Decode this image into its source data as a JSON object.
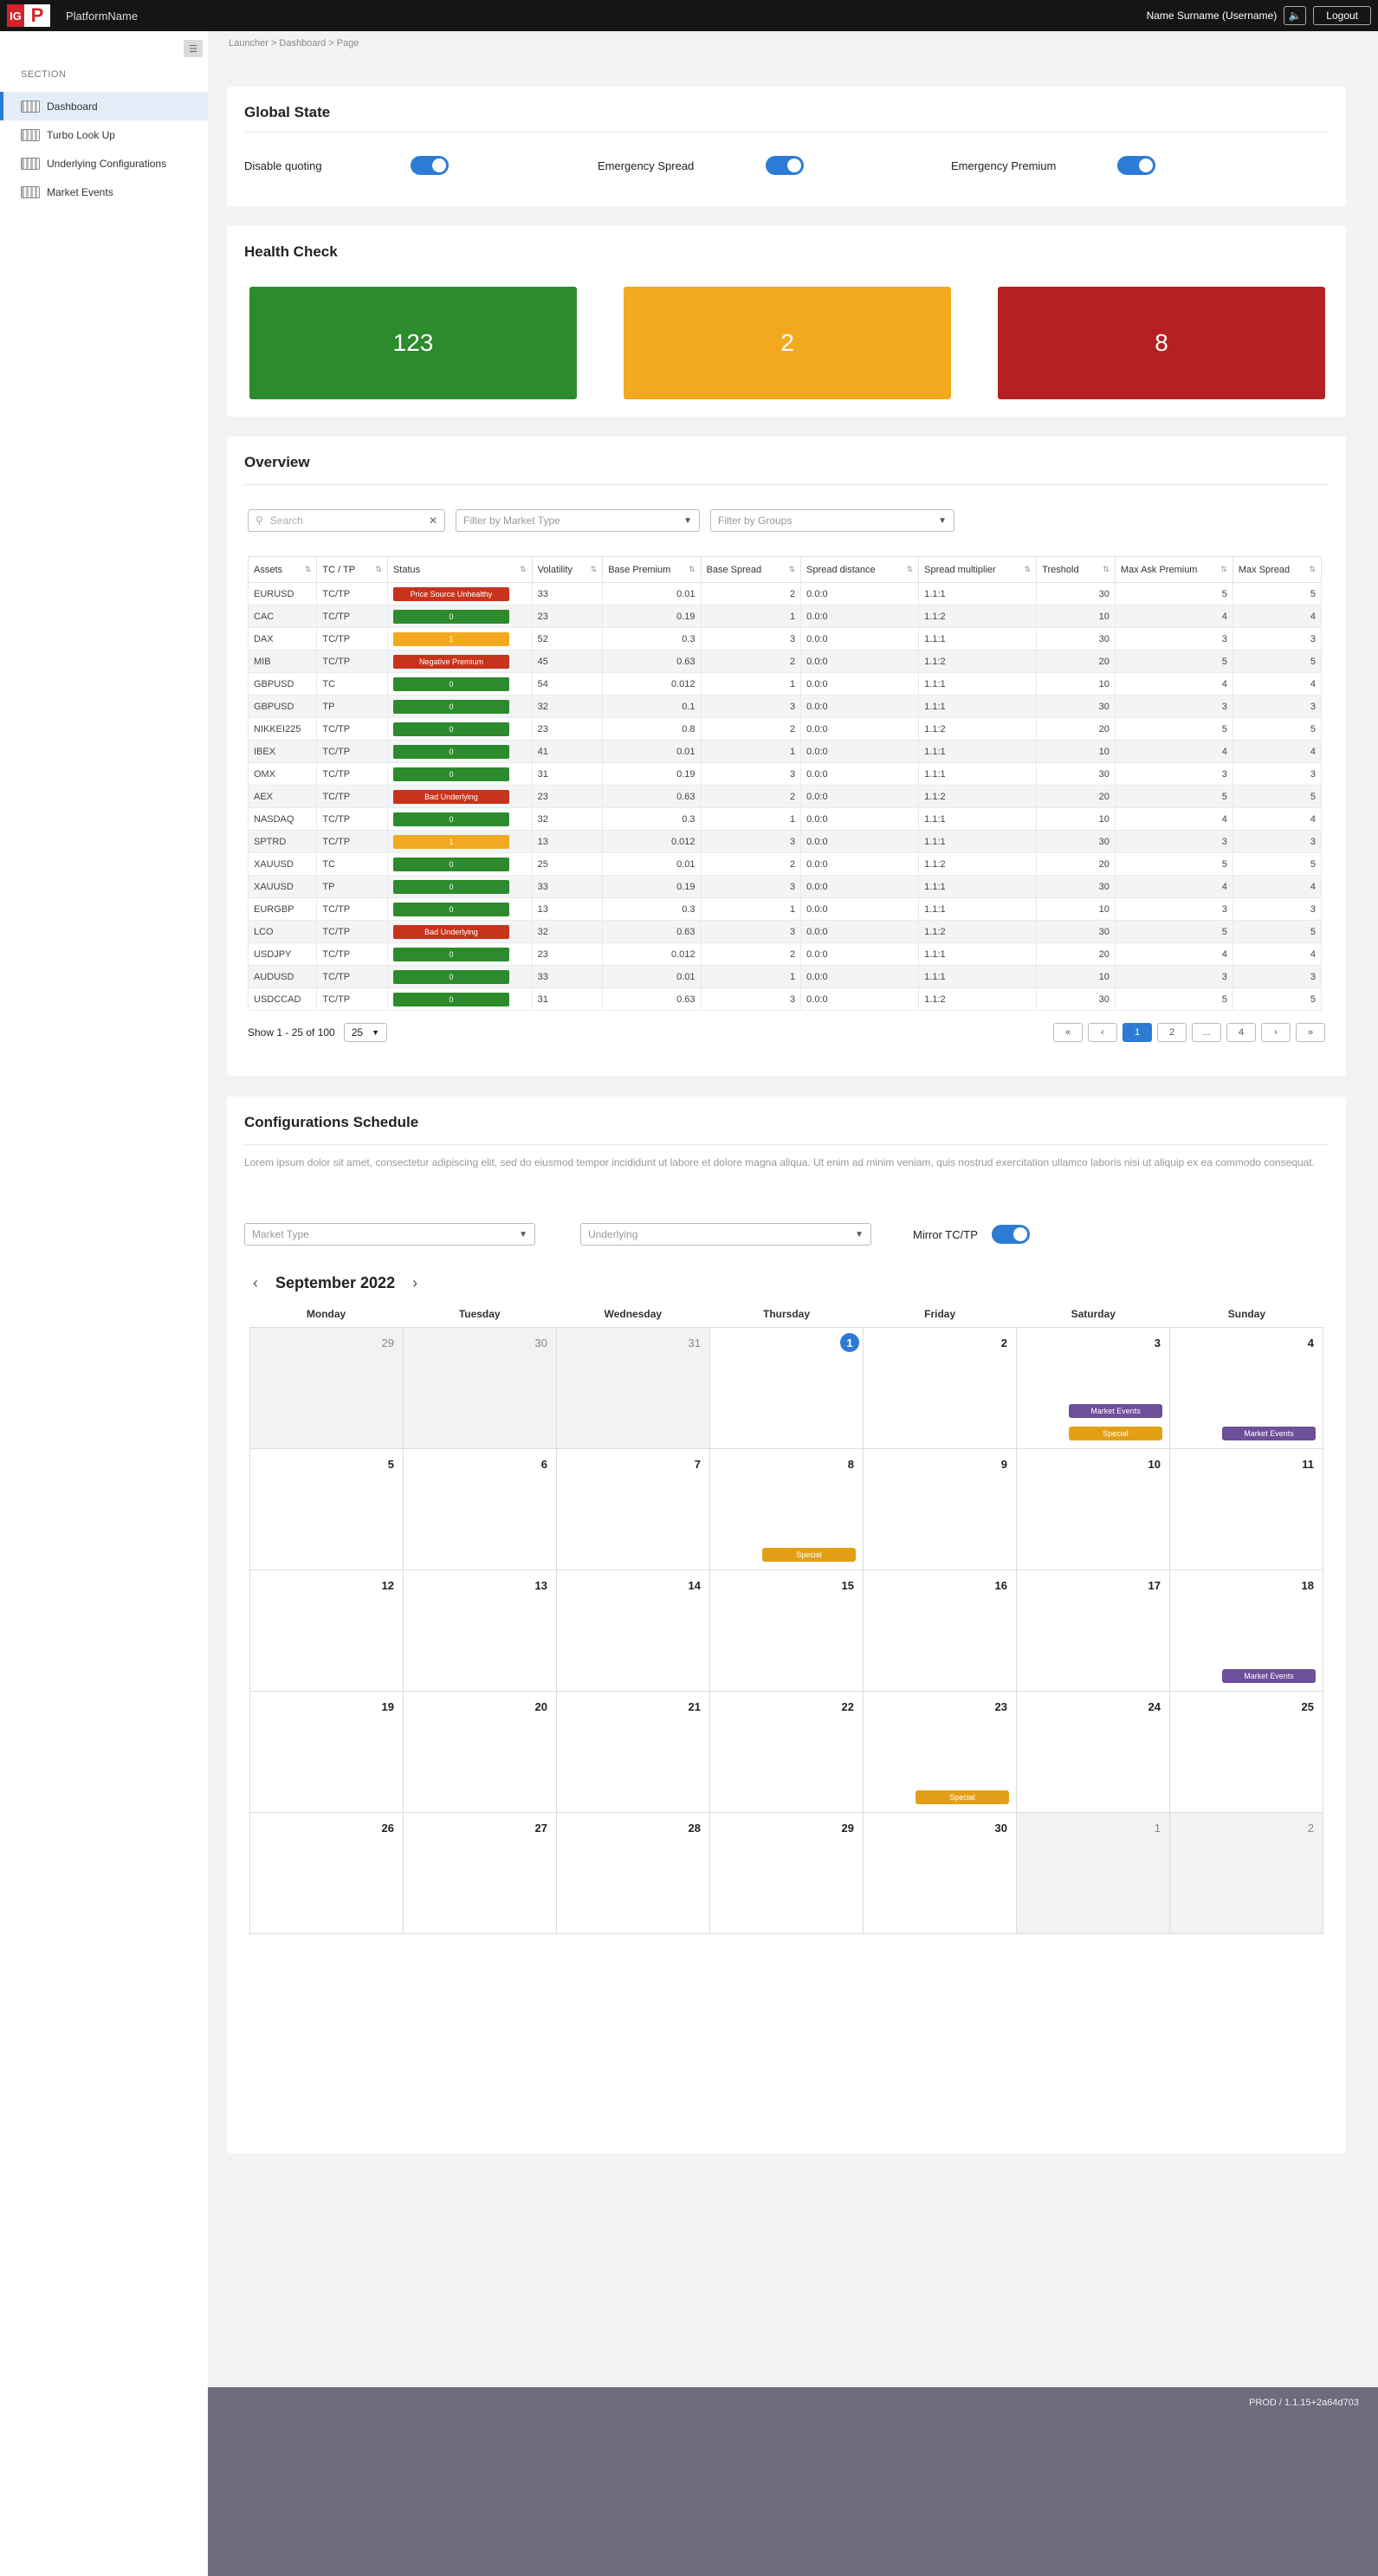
{
  "header": {
    "logo_ig": "IG",
    "logo_p": "P",
    "platform": "PlatformName",
    "username": "Name Surname (Username)",
    "logout": "Logout",
    "sound_icon": "speaker-icon"
  },
  "sidebar": {
    "section": "SECTION",
    "items": [
      {
        "label": "Dashboard",
        "active": true
      },
      {
        "label": "Turbo Look Up"
      },
      {
        "label": "Underlying Configurations"
      },
      {
        "label": "Market Events"
      }
    ]
  },
  "breadcrumb": "Launcher > Dashboard > Page",
  "global_state": {
    "title": "Global State",
    "items": [
      {
        "label": "Disable quoting",
        "on": true
      },
      {
        "label": "Emergency Spread",
        "on": true
      },
      {
        "label": "Emergency Premium",
        "on": true
      }
    ]
  },
  "health_check": {
    "title": "Health Check",
    "tiles": [
      {
        "value": "123",
        "color": "#2c8b2c"
      },
      {
        "value": "2",
        "color": "#f2a91e"
      },
      {
        "value": "8",
        "color": "#b52122"
      }
    ]
  },
  "overview": {
    "title": "Overview",
    "search_placeholder": "Search",
    "filter_market": "Filter by Market Type",
    "filter_groups": "Filter by Groups",
    "columns": [
      "Assets",
      "TC / TP",
      "Status",
      "Volatility",
      "Base Premium",
      "Base Spread",
      "Spread distance",
      "Spread multiplier",
      "Treshold",
      "Max Ask Premium",
      "Max Spread"
    ],
    "rows": [
      [
        "EURUSD",
        "TC/TP",
        "Price Source Unhealthy",
        "33",
        "0.01",
        "2",
        "0.0:0",
        "1.1:1",
        "30",
        "5",
        "5"
      ],
      [
        "CAC",
        "TC/TP",
        "0",
        "23",
        "0.19",
        "1",
        "0.0:0",
        "1.1:2",
        "10",
        "4",
        "4"
      ],
      [
        "DAX",
        "TC/TP",
        "1",
        "52",
        "0.3",
        "3",
        "0.0:0",
        "1.1:1",
        "30",
        "3",
        "3"
      ],
      [
        "MIB",
        "TC/TP",
        "Negative Premium",
        "45",
        "0.63",
        "2",
        "0.0:0",
        "1.1:2",
        "20",
        "5",
        "5"
      ],
      [
        "GBPUSD",
        "TC",
        "0",
        "54",
        "0.012",
        "1",
        "0.0:0",
        "1.1:1",
        "10",
        "4",
        "4"
      ],
      [
        "GBPUSD",
        "TP",
        "0",
        "32",
        "0.1",
        "3",
        "0.0:0",
        "1.1:1",
        "30",
        "3",
        "3"
      ],
      [
        "NIKKEI225",
        "TC/TP",
        "0",
        "23",
        "0.8",
        "2",
        "0.0:0",
        "1.1:2",
        "20",
        "5",
        "5"
      ],
      [
        "IBEX",
        "TC/TP",
        "0",
        "41",
        "0.01",
        "1",
        "0.0:0",
        "1.1:1",
        "10",
        "4",
        "4"
      ],
      [
        "OMX",
        "TC/TP",
        "0",
        "31",
        "0.19",
        "3",
        "0.0:0",
        "1.1:1",
        "30",
        "3",
        "3"
      ],
      [
        "AEX",
        "TC/TP",
        "Bad Underlying",
        "23",
        "0.63",
        "2",
        "0.0:0",
        "1.1:2",
        "20",
        "5",
        "5"
      ],
      [
        "NASDAQ",
        "TC/TP",
        "0",
        "32",
        "0.3",
        "1",
        "0.0:0",
        "1.1:1",
        "10",
        "4",
        "4"
      ],
      [
        "SPTRD",
        "TC/TP",
        "1",
        "13",
        "0.012",
        "3",
        "0.0:0",
        "1.1:1",
        "30",
        "3",
        "3"
      ],
      [
        "XAUUSD",
        "TC",
        "0",
        "25",
        "0.01",
        "2",
        "0.0:0",
        "1.1:2",
        "20",
        "5",
        "5"
      ],
      [
        "XAUUSD",
        "TP",
        "0",
        "33",
        "0.19",
        "3",
        "0.0:0",
        "1.1:1",
        "30",
        "4",
        "4"
      ],
      [
        "EURGBP",
        "TC/TP",
        "0",
        "13",
        "0.3",
        "1",
        "0.0:0",
        "1.1:1",
        "10",
        "3",
        "3"
      ],
      [
        "LCO",
        "TC/TP",
        "Bad Underlying",
        "32",
        "0.63",
        "3",
        "0.0:0",
        "1.1:2",
        "30",
        "5",
        "5"
      ],
      [
        "USDJPY",
        "TC/TP",
        "0",
        "23",
        "0.012",
        "2",
        "0.0:0",
        "1.1:1",
        "20",
        "4",
        "4"
      ],
      [
        "AUDUSD",
        "TC/TP",
        "0",
        "33",
        "0.01",
        "1",
        "0.0:0",
        "1.1:1",
        "10",
        "3",
        "3"
      ],
      [
        "USDCCAD",
        "TC/TP",
        "0",
        "31",
        "0.63",
        "3",
        "0.0:0",
        "1.1:2",
        "30",
        "5",
        "5"
      ]
    ],
    "badge_colors": {
      "red": "#c8331b",
      "green": "#2c8b2c",
      "orange": "#f2a91e"
    },
    "show_text": "Show 1 - 25 of 100",
    "page_size": "25",
    "pages": [
      "«",
      "‹",
      "1",
      "2",
      "...",
      "4",
      "›",
      "»"
    ]
  },
  "schedule": {
    "title": "Configurations Schedule",
    "lorem": "Lorem ipsum dolor sit amet, consectetur adipiscing elit, sed do eiusmod tempor incididunt ut labore et dolore magna aliqua. Ut enim ad minim veniam, quis nostrud exercitation ullamco laboris nisi ut aliquip ex ea commodo consequat.",
    "market_type": "Market Type",
    "underlying": "Underlying",
    "mirror": "Mirror TC/TP",
    "month": "September 2022",
    "dow": [
      "Monday",
      "Tuesday",
      "Wednesday",
      "Thursday",
      "Friday",
      "Saturday",
      "Sunday"
    ],
    "days": [
      {
        "d": "29",
        "out": true
      },
      {
        "d": "30",
        "out": true
      },
      {
        "d": "31",
        "out": true
      },
      {
        "d": "1",
        "today": true
      },
      {
        "d": "2"
      },
      {
        "d": "3",
        "events": [
          "Market Events",
          "Special"
        ]
      },
      {
        "d": "4",
        "events": [
          "Market Events"
        ]
      },
      {
        "d": "5"
      },
      {
        "d": "6"
      },
      {
        "d": "7"
      },
      {
        "d": "8",
        "events": [
          "Special"
        ]
      },
      {
        "d": "9"
      },
      {
        "d": "10"
      },
      {
        "d": "11"
      },
      {
        "d": "12"
      },
      {
        "d": "13"
      },
      {
        "d": "14"
      },
      {
        "d": "15"
      },
      {
        "d": "16"
      },
      {
        "d": "17"
      },
      {
        "d": "18",
        "events": [
          "Market Events"
        ]
      },
      {
        "d": "19"
      },
      {
        "d": "20"
      },
      {
        "d": "21"
      },
      {
        "d": "22"
      },
      {
        "d": "23",
        "events": [
          "Special"
        ]
      },
      {
        "d": "24"
      },
      {
        "d": "25"
      },
      {
        "d": "26"
      },
      {
        "d": "27"
      },
      {
        "d": "28"
      },
      {
        "d": "29"
      },
      {
        "d": "30"
      },
      {
        "d": "1",
        "out": true
      },
      {
        "d": "2",
        "out": true
      }
    ],
    "event_colors": {
      "Market Events": "#6d4f9a",
      "Special": "#e3a017"
    }
  },
  "footer": {
    "version": "PROD / 1.1.15+2a64d703"
  }
}
